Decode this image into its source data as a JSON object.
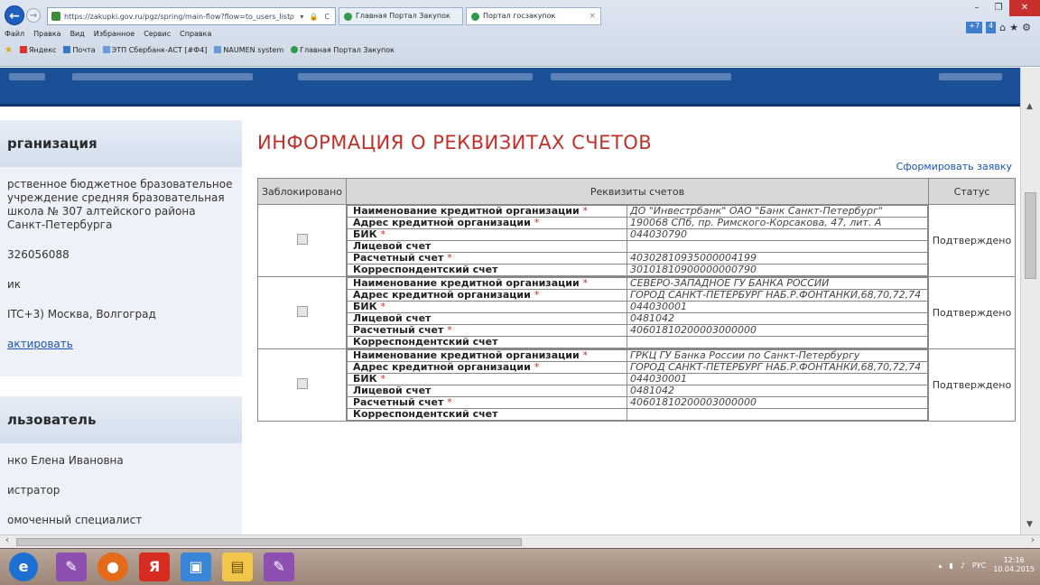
{
  "browser": {
    "url": "https://zakupki.gov.ru/pgz/spring/main-flow?flow=to_users_list",
    "tabs": [
      {
        "label": "Главная Портал Закупок"
      },
      {
        "label": "Портал госзакупок"
      }
    ],
    "close_tab": "×",
    "address_tools": "ρ ▾ 🔒 C",
    "menu": [
      "Файл",
      "Правка",
      "Вид",
      "Избранное",
      "Сервис",
      "Справка"
    ],
    "favorites": [
      "Яндекс",
      "Почта",
      "ЭТП Сбербанк-АСТ [#Ф4]",
      "NAUMEN system",
      "Главная Портал Закупок"
    ],
    "right_tools": {
      "badge1": "+7",
      "badge2": "4"
    },
    "win": {
      "min": "–",
      "max": "❐",
      "close": "✕"
    }
  },
  "sidebar": {
    "org_title": "рганизация",
    "org_name": "рственное бюджетное бразовательное учреждение средняя бразовательная школа № 307 алтейского района Санкт-Петербурга",
    "inn": "326056088",
    "kind": "ик",
    "timezone": "ITC+3) Москва, Волгоград",
    "edit_link": "актировать",
    "user_title": "льзователь",
    "user_name": "нко Елена Ивановна",
    "role": "истратор",
    "position": "омоченный специалист"
  },
  "main": {
    "title": "ИНФОРМАЦИЯ О РЕКВИЗИТАХ СЧЕТОВ",
    "form_link": "Сформировать заявку",
    "columns": [
      "Заблокировано",
      "Реквизиты счетов",
      "Статус"
    ],
    "star": "*",
    "labels": {
      "bank_name": "Наименование кредитной организации",
      "bank_addr": "Адрес кредитной организации",
      "bik": "БИК",
      "personal": "Лицевой счет",
      "settlement": "Расчетный счет",
      "corr": "Корреспондентский счет"
    },
    "accounts": [
      {
        "bank_name": "ДО \"Инвестрбанк\" ОАО \"Банк Санкт-Петербург\"",
        "bank_addr": "190068 СПб, пр. Римского-Корсакова, 47, лит. А",
        "bik": "044030790",
        "personal": "",
        "settlement": "40302810935000004199",
        "corr": "30101810900000000790",
        "status": "Подтверждено"
      },
      {
        "bank_name": "СЕВЕРО-ЗАПАДНОЕ ГУ БАНКА РОССИИ",
        "bank_addr": "ГОРОД САНКТ-ПЕТЕРБУРГ НАБ.Р.ФОНТАНКИ,68,70,72,74",
        "bik": "044030001",
        "personal": "0481042",
        "settlement": "40601810200003000000",
        "corr": "",
        "status": "Подтверждено"
      },
      {
        "bank_name": "ГРКЦ ГУ Банка России по Санкт-Петербургу",
        "bank_addr": "ГОРОД САНКТ-ПЕТЕРБУРГ НАБ.Р.ФОНТАНКИ,68,70,72,74",
        "bik": "044030001",
        "personal": "0481042",
        "settlement": "40601810200003000000",
        "corr": "",
        "status": "Подтверждено"
      }
    ]
  },
  "taskbar": {
    "apps": [
      "ie-icon",
      "app-icon",
      "firefox-icon",
      "yandex-icon",
      "windows-explorer-icon",
      "folder-icon",
      "app-icon-2"
    ],
    "yandex_letter": "Я",
    "lang": "РУС",
    "time": "12:16",
    "date": "10.04.2015"
  }
}
